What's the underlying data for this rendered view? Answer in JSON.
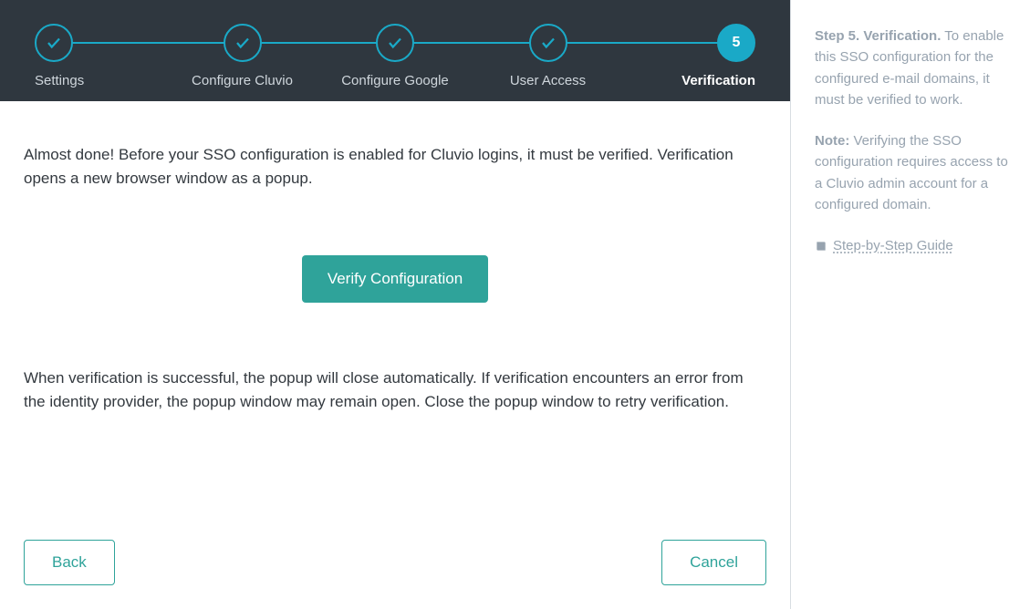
{
  "stepper": {
    "steps": [
      {
        "label": "Settings",
        "state": "done"
      },
      {
        "label": "Configure Cluvio",
        "state": "done"
      },
      {
        "label": "Configure Google",
        "state": "done"
      },
      {
        "label": "User Access",
        "state": "done"
      },
      {
        "label": "Verification",
        "state": "current",
        "display": "5"
      }
    ]
  },
  "main": {
    "intro": "Almost done! Before your SSO configuration is enabled for Cluvio logins, it must be verified. Verification opens a new browser window as a popup.",
    "verify_button": "Verify Configuration",
    "outro": "When verification is successful, the popup will close automatically. If verification encounters an error from the identity provider, the popup window may remain open. Close the popup window to retry verification.",
    "back_button": "Back",
    "cancel_button": "Cancel"
  },
  "sidebar": {
    "heading": "Step 5. Verification.",
    "heading_rest": " To enable this SSO configuration for the configured e-mail domains, it must be verified to work.",
    "note_label": "Note:",
    "note_rest": " Verifying the SSO configuration requires access to a Cluvio admin account for a configured domain.",
    "guide_label": "Step-by-Step Guide"
  },
  "colors": {
    "header_bg": "#2f373f",
    "accent_cyan": "#1aa9c7",
    "accent_teal": "#2fa39a",
    "sidebar_text": "#97a3af"
  }
}
